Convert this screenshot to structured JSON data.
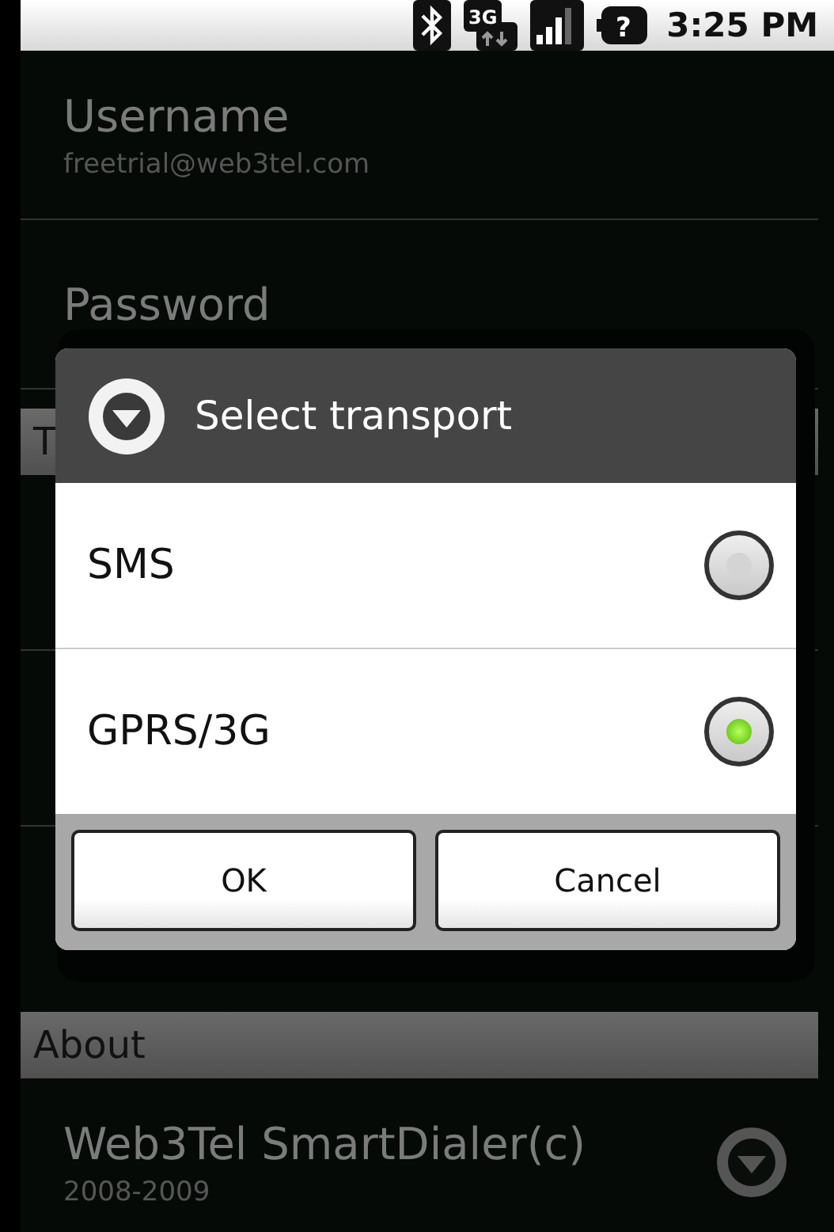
{
  "status_bar": {
    "network": "3G",
    "battery": "?",
    "time": "3:25 PM"
  },
  "settings": [
    {
      "kind": "item",
      "title": "Username",
      "summary": "freetrial@web3tel.com"
    },
    {
      "kind": "item",
      "title": "Password"
    },
    {
      "kind": "header",
      "title": "T"
    },
    {
      "kind": "blank"
    },
    {
      "kind": "blank"
    },
    {
      "kind": "blank"
    },
    {
      "kind": "header",
      "title": "About"
    },
    {
      "kind": "dropdown",
      "title": "Web3Tel SmartDialer(c)",
      "summary": "2008-2009"
    }
  ],
  "dialog": {
    "title": "Select transport",
    "options": [
      {
        "label": "SMS",
        "selected": false
      },
      {
        "label": "GPRS/3G",
        "selected": true
      }
    ],
    "buttons": [
      "OK",
      "Cancel"
    ]
  }
}
